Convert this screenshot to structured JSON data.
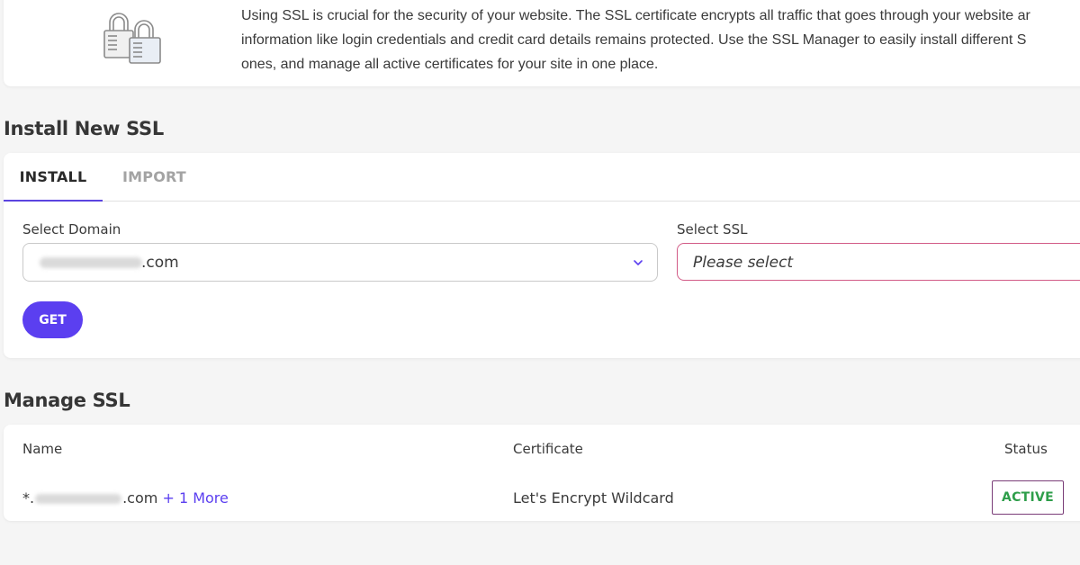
{
  "intro": {
    "icon": "padlocks-icon",
    "lines": [
      "Using SSL is crucial for the security of your website. The SSL certificate encrypts all traffic that goes through your website ar",
      "information like login credentials and credit card details remains protected. Use the SSL Manager to easily install different S",
      "ones, and manage all active certificates for your site in one place."
    ]
  },
  "install": {
    "title": "Install New SSL",
    "tabs": [
      {
        "label": "INSTALL",
        "active": true
      },
      {
        "label": "IMPORT",
        "active": false
      }
    ],
    "domain_label": "Select Domain",
    "domain_value_suffix": ".com",
    "ssl_label": "Select SSL",
    "ssl_placeholder": "Please select",
    "get_label": "GET"
  },
  "manage": {
    "title": "Manage SSL",
    "columns": [
      "Name",
      "Certificate",
      "Status"
    ],
    "rows": [
      {
        "name_prefix": "*.",
        "name_suffix": ".com",
        "more": "+ 1 More",
        "certificate": "Let's Encrypt Wildcard",
        "status": "ACTIVE"
      }
    ]
  },
  "colors": {
    "accent": "#5b3ff0",
    "active_status": "#2e9e4a",
    "ssl_select_border": "#d25b87",
    "background": "#f5f5f5"
  }
}
